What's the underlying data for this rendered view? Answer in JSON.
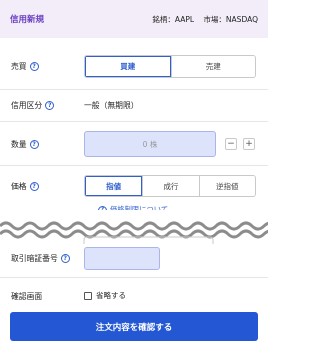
{
  "header": {
    "title": "信用新規",
    "symbol_label": "銘柄：AAPL",
    "market_label": "市場：NASDAQ"
  },
  "side": {
    "label": "売買",
    "options": [
      {
        "label": "買建",
        "active": true
      },
      {
        "label": "売建",
        "active": false
      }
    ]
  },
  "margin_type": {
    "label": "信用区分",
    "value": "一般（無期限）"
  },
  "quantity": {
    "label": "数量",
    "placeholder": "0 株",
    "minus": "−",
    "plus": "+"
  },
  "price": {
    "label": "価格",
    "options": [
      {
        "label": "指値",
        "active": true
      },
      {
        "label": "成行",
        "active": false
      },
      {
        "label": "逆指値",
        "active": false
      }
    ],
    "limit_link": "価格制限について"
  },
  "certificate": {
    "label": "取引暗証番号"
  },
  "confirm_screen": {
    "label": "確認画面",
    "checkbox_label": "省略する",
    "checked": false
  },
  "submit_label": "注文内容を確認する",
  "help_glyph": "?",
  "colors": {
    "accent": "#2357d3",
    "header_bg": "#f2edf8",
    "header_title": "#6a3fc1",
    "input_bg": "#dde3fb"
  }
}
